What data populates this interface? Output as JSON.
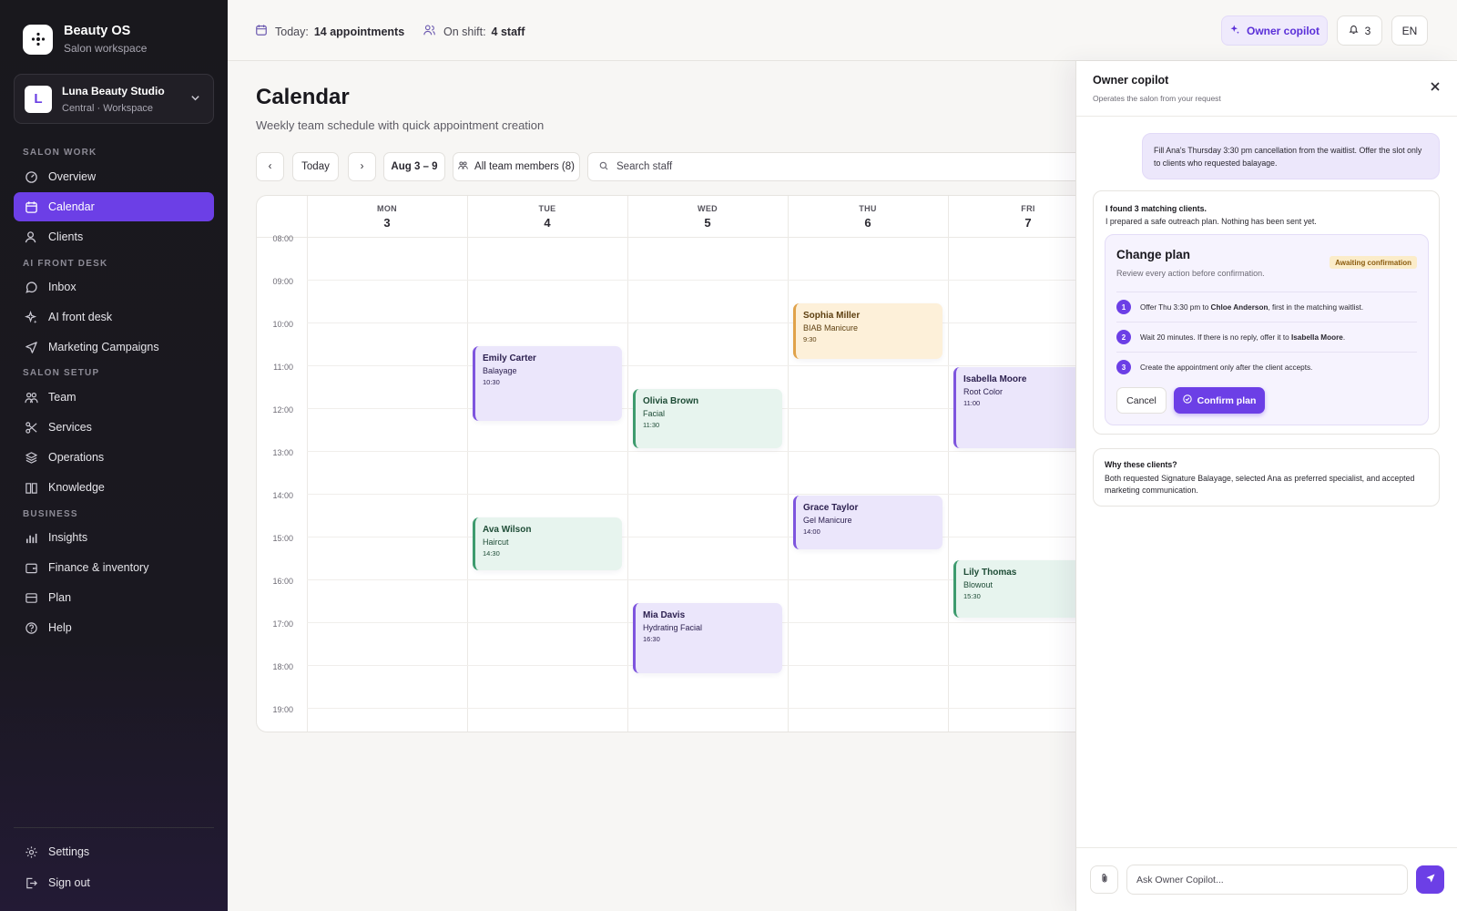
{
  "sidebar": {
    "brand_title": "Beauty OS",
    "brand_sub": "Salon workspace",
    "workspace": {
      "avatar": "L",
      "name": "Luna Beauty Studio",
      "sub": "Central · Workspace"
    },
    "sections": [
      "SALON WORK",
      "AI FRONT DESK",
      "SALON SETUP",
      "BUSINESS"
    ],
    "items": [
      {
        "label": "Overview",
        "icon": "gauge-icon"
      },
      {
        "label": "Calendar",
        "icon": "calendar-icon",
        "active": true
      },
      {
        "label": "Clients",
        "icon": "user-icon"
      },
      {
        "label": "Inbox",
        "icon": "chat-icon"
      },
      {
        "label": "AI front desk",
        "icon": "sparkles-icon"
      },
      {
        "label": "Marketing Campaigns",
        "icon": "send-icon"
      },
      {
        "label": "Team",
        "icon": "team-icon"
      },
      {
        "label": "Services",
        "icon": "scissors-icon"
      },
      {
        "label": "Operations",
        "icon": "layers-icon"
      },
      {
        "label": "Knowledge",
        "icon": "book-icon"
      },
      {
        "label": "Insights",
        "icon": "bar-chart-icon"
      },
      {
        "label": "Finance & inventory",
        "icon": "wallet-icon"
      },
      {
        "label": "Plan",
        "icon": "card-icon"
      },
      {
        "label": "Help",
        "icon": "help-icon"
      }
    ],
    "footer": [
      {
        "label": "Settings",
        "icon": "gear-icon"
      },
      {
        "label": "Sign out",
        "icon": "sign-out-icon"
      }
    ]
  },
  "topbar": {
    "today_label": "Today:",
    "today_value": "14 appointments",
    "shift_label": "On shift:",
    "shift_value": "4 staff",
    "copilot_button": "Owner copilot",
    "notifications_count": "3",
    "language": "EN"
  },
  "main": {
    "title": "Calendar",
    "subtitle": "Weekly team schedule with quick appointment creation",
    "toolbar": {
      "prev": "‹",
      "today": "Today",
      "next": "›",
      "range": "Aug 3 – 9",
      "team_filter": "All team members (8)",
      "search_placeholder": "Search staff"
    }
  },
  "calendar": {
    "days": [
      {
        "name": "MON",
        "date": "3"
      },
      {
        "name": "TUE",
        "date": "4"
      },
      {
        "name": "WED",
        "date": "5"
      },
      {
        "name": "THU",
        "date": "6"
      },
      {
        "name": "FRI",
        "date": "7"
      }
    ],
    "hours": [
      "08:00",
      "09:00",
      "10:00",
      "11:00",
      "12:00",
      "13:00",
      "14:00",
      "15:00",
      "16:00",
      "17:00",
      "18:00",
      "19:00"
    ],
    "appointments": [
      {
        "day": 1,
        "start": 10.5,
        "end": 12.25,
        "client": "Emily Carter",
        "service": "Balayage",
        "time": "10:30",
        "color": "purple"
      },
      {
        "day": 1,
        "start": 14.5,
        "end": 15.75,
        "client": "Ava Wilson",
        "service": "Haircut",
        "time": "14:30",
        "color": "green"
      },
      {
        "day": 2,
        "start": 11.5,
        "end": 12.9,
        "client": "Olivia Brown",
        "service": "Facial",
        "time": "11:30",
        "color": "green"
      },
      {
        "day": 2,
        "start": 16.5,
        "end": 18.15,
        "client": "Mia Davis",
        "service": "Hydrating Facial",
        "time": "16:30",
        "color": "purple"
      },
      {
        "day": 3,
        "start": 9.5,
        "end": 10.8,
        "client": "Sophia Miller",
        "service": "BIAB Manicure",
        "time": "9:30",
        "color": "orange"
      },
      {
        "day": 3,
        "start": 14.0,
        "end": 15.25,
        "client": "Grace Taylor",
        "service": "Gel Manicure",
        "time": "14:00",
        "color": "purple"
      },
      {
        "day": 4,
        "start": 11.0,
        "end": 12.9,
        "client": "Isabella Moore",
        "service": "Root Color",
        "time": "11:00",
        "color": "purple"
      },
      {
        "day": 4,
        "start": 15.5,
        "end": 16.85,
        "client": "Lily Thomas",
        "service": "Blowout",
        "time": "15:30",
        "color": "green"
      }
    ]
  },
  "copilot": {
    "title": "Owner copilot",
    "subtitle": "Operates the salon from your request",
    "user_message": "Fill Ana's Thursday 3:30 pm cancellation from the waitlist. Offer the slot only to clients who requested balayage.",
    "reply_bold": "I found 3 matching clients.",
    "reply_text": "I prepared a safe outreach plan. Nothing has been sent yet.",
    "plan": {
      "title": "Change plan",
      "subtitle": "Review every action before confirmation.",
      "badge": "Awaiting confirmation",
      "steps": [
        {
          "num": "1",
          "pre": "Offer Thu 3:30 pm to ",
          "bold": "Chloe Anderson",
          "post": ", first in the matching waitlist."
        },
        {
          "num": "2",
          "pre": "Wait 20 minutes. If there is no reply, offer it to ",
          "bold": "Isabella Moore",
          "post": "."
        },
        {
          "num": "3",
          "pre": "Create the appointment only after the client accepts.",
          "bold": "",
          "post": ""
        }
      ],
      "cancel": "Cancel",
      "confirm": "Confirm plan"
    },
    "why_title": "Why these clients?",
    "why_text": "Both requested Signature Balayage, selected Ana as preferred specialist, and accepted marketing communication.",
    "input_placeholder": "Ask Owner Copilot..."
  },
  "colors": {
    "accent": "#6c3fe6",
    "sidebar_bg": "#19181d",
    "purple_event": "#ebe6fb",
    "green_event": "#e7f4ee",
    "orange_event": "#fdf0d9",
    "badge_bg": "#fbecc9"
  }
}
